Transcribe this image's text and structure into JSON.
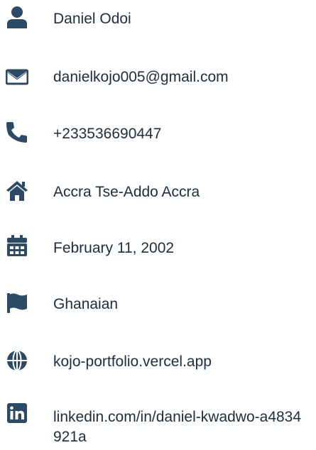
{
  "contact": {
    "icon_color": "#2c4a63",
    "items": [
      {
        "icon": "user-icon",
        "text": "Daniel Odoi"
      },
      {
        "icon": "envelope-icon",
        "text": "danielkojo005@gmail.com"
      },
      {
        "icon": "phone-icon",
        "text": "+233536690447"
      },
      {
        "icon": "home-icon",
        "text": "Accra Tse-Addo Accra"
      },
      {
        "icon": "calendar-icon",
        "text": "February 11, 2002"
      },
      {
        "icon": "flag-icon",
        "text": "Ghanaian"
      },
      {
        "icon": "globe-icon",
        "text": "kojo-portfolio.vercel.app"
      },
      {
        "icon": "linkedin-icon",
        "text": "linkedin.com/in/daniel-kwadwo-a4834921a"
      }
    ]
  }
}
